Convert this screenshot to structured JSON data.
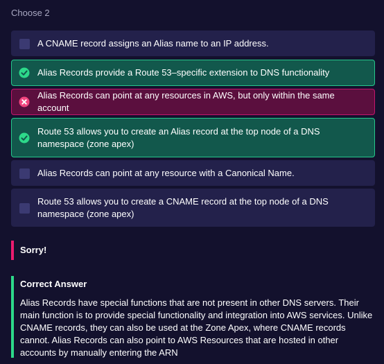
{
  "question": {
    "prompt": "Choose 2",
    "options": [
      {
        "text": "A CNAME record assigns an Alias name to an IP address.",
        "state": "unselected"
      },
      {
        "text": "Alias Records provide a Route 53–specific extension to DNS functionality",
        "state": "correct"
      },
      {
        "text": "Alias Records can point at any resources in AWS, but only within the same account",
        "state": "wrong"
      },
      {
        "text": "Route 53 allows you to create an Alias record at the top node of a DNS namespace (zone apex)",
        "state": "correct"
      },
      {
        "text": "Alias Records can point at any resource with a Canonical Name.",
        "state": "unselected"
      },
      {
        "text": "Route 53 allows you to create a CNAME record at the top node of a DNS namespace (zone apex)",
        "state": "unselected"
      }
    ]
  },
  "feedback": {
    "result_label": "Sorry!",
    "correct_title": "Correct Answer",
    "explanation": "Alias Records have special functions that are not present in other DNS servers. Their main function is to provide special functionality and integration into AWS services. Unlike CNAME records, they can also be used at the Zone Apex, where CNAME records cannot. Alias Records can also point to AWS Resources that are hosted in other accounts by manually entering the ARN"
  },
  "colors": {
    "background": "#13112d",
    "option": "#23214b",
    "correct": "#25c88b",
    "wrong": "#ec1c6f"
  },
  "icons": {
    "correct": "check-circle-icon",
    "wrong": "x-circle-icon",
    "unselected": "checkbox-square"
  }
}
